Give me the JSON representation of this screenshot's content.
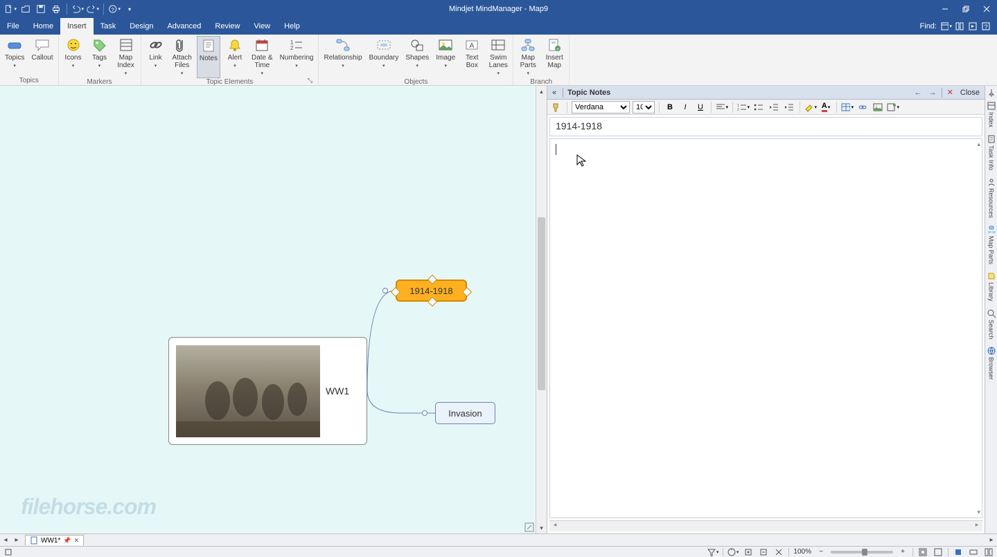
{
  "app_title": "Mindjet MindManager - Map9",
  "find_label": "Find:",
  "menu": {
    "items": [
      "File",
      "Home",
      "Insert",
      "Task",
      "Design",
      "Advanced",
      "Review",
      "View",
      "Help"
    ],
    "active_index": 2
  },
  "ribbon": {
    "groups": [
      {
        "label": "Topics",
        "buttons": [
          {
            "name": "topics",
            "label": "Topics",
            "dd": true
          },
          {
            "name": "callout",
            "label": "Callout",
            "dd": false
          }
        ]
      },
      {
        "label": "Markers",
        "buttons": [
          {
            "name": "icons",
            "label": "Icons",
            "dd": true
          },
          {
            "name": "tags",
            "label": "Tags",
            "dd": true
          },
          {
            "name": "map-index",
            "label": "Map\nIndex",
            "dd": true
          }
        ]
      },
      {
        "label": "Topic Elements",
        "launcher": true,
        "buttons": [
          {
            "name": "link",
            "label": "Link",
            "dd": true
          },
          {
            "name": "attach-files",
            "label": "Attach\nFiles",
            "dd": true
          },
          {
            "name": "notes",
            "label": "Notes",
            "dd": false,
            "active": true
          },
          {
            "name": "alert",
            "label": "Alert",
            "dd": true
          },
          {
            "name": "date-time",
            "label": "Date &\nTime",
            "dd": true
          },
          {
            "name": "numbering",
            "label": "Numbering",
            "dd": true
          }
        ]
      },
      {
        "label": "Objects",
        "buttons": [
          {
            "name": "relationship",
            "label": "Relationship",
            "dd": true
          },
          {
            "name": "boundary",
            "label": "Boundary",
            "dd": true
          },
          {
            "name": "shapes",
            "label": "Shapes",
            "dd": true
          },
          {
            "name": "image",
            "label": "Image",
            "dd": true
          },
          {
            "name": "text-box",
            "label": "Text\nBox",
            "dd": false
          },
          {
            "name": "swim-lanes",
            "label": "Swim\nLanes",
            "dd": true
          }
        ]
      },
      {
        "label": "Branch",
        "buttons": [
          {
            "name": "map-parts",
            "label": "Map\nParts",
            "dd": true
          },
          {
            "name": "insert-map",
            "label": "Insert\nMap",
            "dd": false
          }
        ]
      }
    ]
  },
  "canvas": {
    "central": "WW1",
    "sub1": "1914-1918",
    "sub2": "Invasion"
  },
  "notes": {
    "panel_title": "Topic Notes",
    "close_label": "Close",
    "font": "Verdana",
    "size": "10",
    "title_text": "1914-1918"
  },
  "right_tabs": [
    "Index",
    "Task Info",
    "Resources",
    "Map Parts",
    "Library",
    "Search",
    "Browser"
  ],
  "doc_tab": {
    "name": "WW1*"
  },
  "status": {
    "zoom": "100%"
  },
  "watermark": "filehorse.com"
}
